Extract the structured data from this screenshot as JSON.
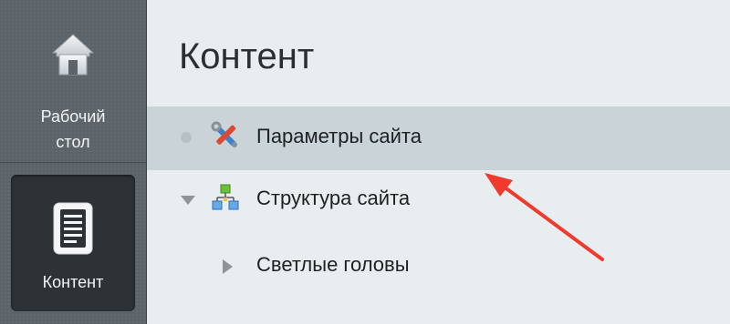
{
  "nav": {
    "desktop_label_line1": "Рабочий",
    "desktop_label_line2": "стол",
    "content_label": "Контент",
    "desktop_icon": "home-icon",
    "content_icon": "document-icon"
  },
  "main": {
    "title": "Контент",
    "tree": [
      {
        "label": "Параметры сайта",
        "icon": "tools-icon",
        "state": "leaf",
        "selected": true
      },
      {
        "label": "Структура сайта",
        "icon": "sitemap-icon",
        "state": "expanded",
        "selected": false
      },
      {
        "label": "Светлые головы",
        "icon": "",
        "state": "collapsed",
        "selected": false
      }
    ]
  },
  "colors": {
    "sidebar": "#5d6469",
    "active_nav": "#2d3236",
    "main_bg": "#e8eef0",
    "selected_row": "#c9d3d8",
    "annotation": "#f03a2e"
  }
}
